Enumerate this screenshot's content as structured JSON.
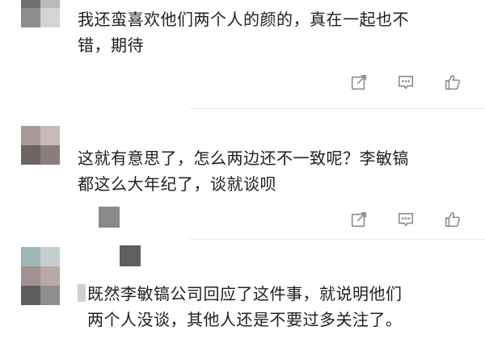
{
  "comments": [
    {
      "text": "我还蛮喜欢他们两个人的颜的，真在一起也不\n错，期待",
      "avatar_colors": [
        "#6f6f6f",
        "#b9b9b9",
        "#8c8c8c",
        "#d4d4d4"
      ]
    },
    {
      "text": "这就有意思了，怎么两边还不一致呢？李敏镐\n都这么大年纪了，谈就谈呗",
      "avatar_colors": [
        "#a99a9c",
        "#c7bab7",
        "#6e6462",
        "#8a7d7b"
      ]
    },
    {
      "text": "既然李敏镐公司回应了这件事，就说明他们\n两个人没谈，其他人还是不要过多关注了。",
      "avatar_colors": [
        "#9fb6b6",
        "#c5cfd0",
        "#a29092",
        "#b8aaa9",
        "#5e5d5d",
        "#8f8e8e"
      ]
    }
  ],
  "icons": {
    "share": "share-icon",
    "reply": "comment-icon",
    "like": "thumbs-up-icon"
  },
  "colors": {
    "icon": "#8a8a8a",
    "text": "#202020",
    "divider": "#ececec"
  }
}
